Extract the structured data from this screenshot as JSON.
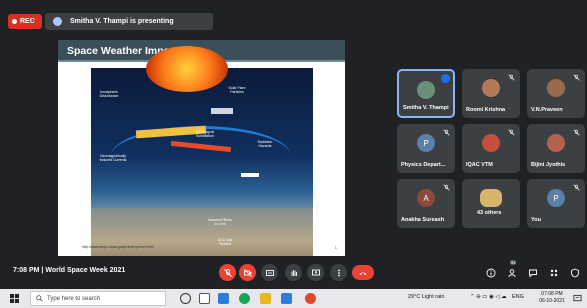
{
  "recording": {
    "label": "REC"
  },
  "presenter_banner": {
    "text": "Smitha V. Thampi is presenting"
  },
  "slide": {
    "title": "Space Weather Impact",
    "labels": [
      "Ionospheric Disturbance",
      "Solar Flare Particles",
      "GPS Signal Scintillation",
      "Radiation Hazards",
      "Geomagnetically Induced Currents",
      "Induced Effects on Grid",
      "Oil & Gas Pipeline"
    ],
    "source_url": "http://www.swpc.noaa.gov/primer/primer.html",
    "page_number": "1"
  },
  "participants": [
    {
      "name": "Smitha V. Thampi",
      "initial": "",
      "avatar_color": "#6b8f7a",
      "speaking": true
    },
    {
      "name": "Roomi Krishna",
      "initial": "",
      "avatar_color": "#b07a5a",
      "speaking": false
    },
    {
      "name": "V.N.Praveen",
      "initial": "",
      "avatar_color": "#9a6b4b",
      "speaking": false
    },
    {
      "name": "Physics Depart...",
      "initial": "P",
      "avatar_color": "#5a7fa8",
      "speaking": false
    },
    {
      "name": "IQAC VTM",
      "initial": "",
      "avatar_color": "#c4503c",
      "speaking": false
    },
    {
      "name": "Bijini Jyothis",
      "initial": "",
      "avatar_color": "#b4624e",
      "speaking": false
    },
    {
      "name": "Anakha Sureash",
      "initial": "A",
      "avatar_color": "#8d4a3a",
      "speaking": false
    },
    {
      "name": "43 others",
      "initial": "",
      "avatar_color": "#d8b46a",
      "speaking": false
    },
    {
      "name": "You",
      "initial": "P",
      "avatar_color": "#5a7fa8",
      "speaking": false
    }
  ],
  "meeting": {
    "time": "7:08 PM",
    "separator": "|",
    "title": "World Space Week 2021"
  },
  "controls": {
    "mic_icon": "mic-off-icon",
    "camera_icon": "camera-off-icon",
    "captions_icon": "captions-icon",
    "hand_icon": "raise-hand-icon",
    "present_icon": "present-icon",
    "more_icon": "more-icon",
    "end_icon": "end-call-icon"
  },
  "right_controls": {
    "people_badge": "53"
  },
  "taskbar": {
    "search_placeholder": "Type here to search",
    "weather": "29°C  Light rain",
    "lang": "ENG",
    "time": "07:08 PM",
    "date": "06-10-2021"
  }
}
